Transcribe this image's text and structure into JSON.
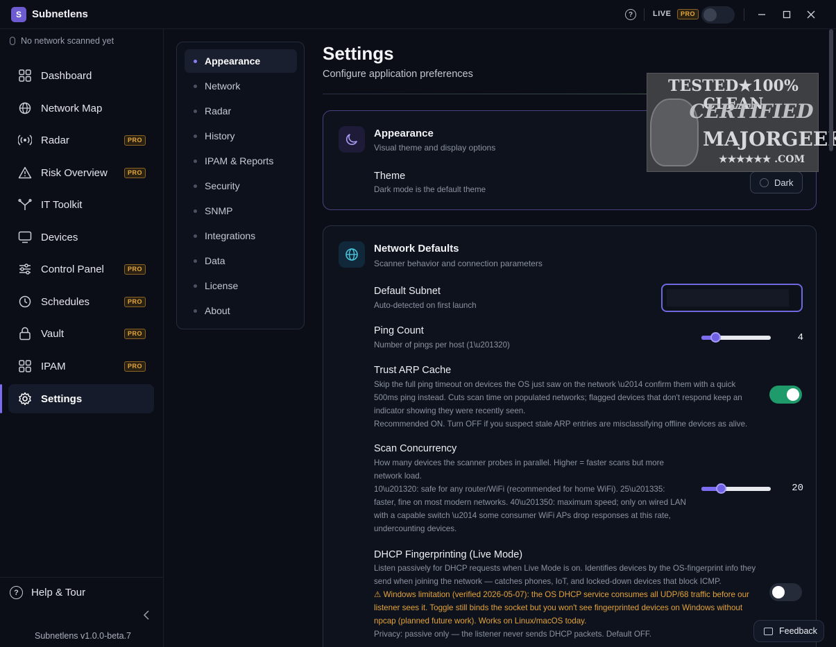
{
  "titlebar": {
    "app_name": "Subnetlens",
    "logo_letter": "S",
    "live_label": "LIVE",
    "pro_label": "PRO",
    "live_mode_on": false
  },
  "sidebar": {
    "scan_status": "No network scanned yet",
    "items": [
      {
        "label": "Dashboard",
        "icon": "grid-icon",
        "pro": false
      },
      {
        "label": "Network Map",
        "icon": "globe-icon",
        "pro": false
      },
      {
        "label": "Radar",
        "icon": "radar-icon",
        "pro": true
      },
      {
        "label": "Risk Overview",
        "icon": "warning-icon",
        "pro": true
      },
      {
        "label": "IT Toolkit",
        "icon": "tools-icon",
        "pro": false
      },
      {
        "label": "Devices",
        "icon": "monitor-icon",
        "pro": false
      },
      {
        "label": "Control Panel",
        "icon": "sliders-icon",
        "pro": true
      },
      {
        "label": "Schedules",
        "icon": "clock-icon",
        "pro": true
      },
      {
        "label": "Vault",
        "icon": "lock-icon",
        "pro": true
      },
      {
        "label": "IPAM",
        "icon": "grid-icon",
        "pro": true
      },
      {
        "label": "Settings",
        "icon": "gear-icon",
        "pro": false,
        "active": true
      }
    ],
    "pro_label": "PRO",
    "help_tour": "Help & Tour",
    "version": "Subnetlens v1.0.0-beta.7"
  },
  "subnav": {
    "items": [
      {
        "label": "Appearance",
        "active": true
      },
      {
        "label": "Network"
      },
      {
        "label": "Radar"
      },
      {
        "label": "History"
      },
      {
        "label": "IPAM & Reports"
      },
      {
        "label": "Security"
      },
      {
        "label": "SNMP"
      },
      {
        "label": "Integrations"
      },
      {
        "label": "Data"
      },
      {
        "label": "License"
      },
      {
        "label": "About"
      }
    ]
  },
  "page": {
    "title": "Settings",
    "subtitle": "Configure application preferences"
  },
  "appearance_card": {
    "title": "Appearance",
    "subtitle": "Visual theme and display options",
    "theme": {
      "title": "Theme",
      "desc": "Dark mode is the default theme",
      "button_label": "Dark"
    }
  },
  "network_card": {
    "title": "Network Defaults",
    "subtitle": "Scanner behavior and connection parameters",
    "default_subnet": {
      "title": "Default Subnet",
      "desc": "Auto-detected on first launch",
      "value": ""
    },
    "ping_count": {
      "title": "Ping Count",
      "desc": "Number of pings per host (1\\u201320)",
      "value": "4",
      "min": 1,
      "max": 20,
      "current": 4
    },
    "trust_arp": {
      "title": "Trust ARP Cache",
      "desc_lines": [
        "Skip the full ping timeout on devices the OS just saw on the network \\u2014 confirm them with a quick",
        "500ms ping instead. Cuts scan time on populated networks; flagged devices that don't respond keep an",
        "indicator showing they were recently seen.",
        "Recommended ON. Turn OFF if you suspect stale ARP entries are misclassifying offline devices as alive."
      ],
      "enabled": true
    },
    "scan_concurrency": {
      "title": "Scan Concurrency",
      "desc_lines": [
        "How many devices the scanner probes in parallel. Higher = faster scans but more",
        "network load.",
        "10\\u201320: safe for any router/WiFi (recommended for home WiFi).  25\\u201335:",
        "faster, fine on most modern networks.  40\\u201350: maximum speed; only on wired LAN",
        "with a capable switch \\u2014 some consumer WiFi APs drop responses at this rate,",
        "undercounting devices."
      ],
      "value": "20",
      "min": 10,
      "max": 50,
      "current": 20
    },
    "dhcp_fingerprinting": {
      "title": "DHCP Fingerprinting (Live Mode)",
      "desc_lines": [
        "Listen passively for DHCP requests when Live Mode is on. Identifies devices by the OS-fingerprint info they",
        "send when joining the network — catches phones, IoT, and locked-down devices that block ICMP."
      ],
      "warning_lines": [
        "⚠ Windows limitation (verified 2026-05-07): the OS DHCP service consumes all UDP/68 traffic before our",
        "listener sees it. Toggle still binds the socket but you won't see fingerprinted devices on Windows without",
        "npcap (planned future work). Works on Linux/macOS today."
      ],
      "privacy_line": "Privacy: passive only — the listener never sends DHCP packets. Default OFF.",
      "enabled": false
    }
  },
  "watermark": {
    "line1": "TESTED★100% CLEAN",
    "line2": "CERTIFIED",
    "line3": "MAJORGEEKS",
    "line4": "★★★★★★ .COM"
  },
  "feedback_label": "Feedback"
}
